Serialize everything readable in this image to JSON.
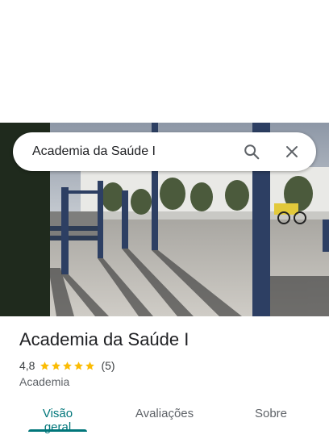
{
  "search": {
    "value": "Academia da Saúde I",
    "search_icon": "search-icon",
    "clear_icon": "close-icon"
  },
  "place": {
    "name": "Academia da Saúde I",
    "rating": "4,8",
    "stars": 5,
    "review_count": "(5)",
    "category": "Academia"
  },
  "tabs": [
    {
      "label": "Visão geral",
      "active": true
    },
    {
      "label": "Avaliações",
      "active": false
    },
    {
      "label": "Sobre",
      "active": false
    }
  ],
  "colors": {
    "accent": "#00767a",
    "star": "#fbbc04",
    "text_primary": "#202124",
    "text_secondary": "#5f6368"
  }
}
